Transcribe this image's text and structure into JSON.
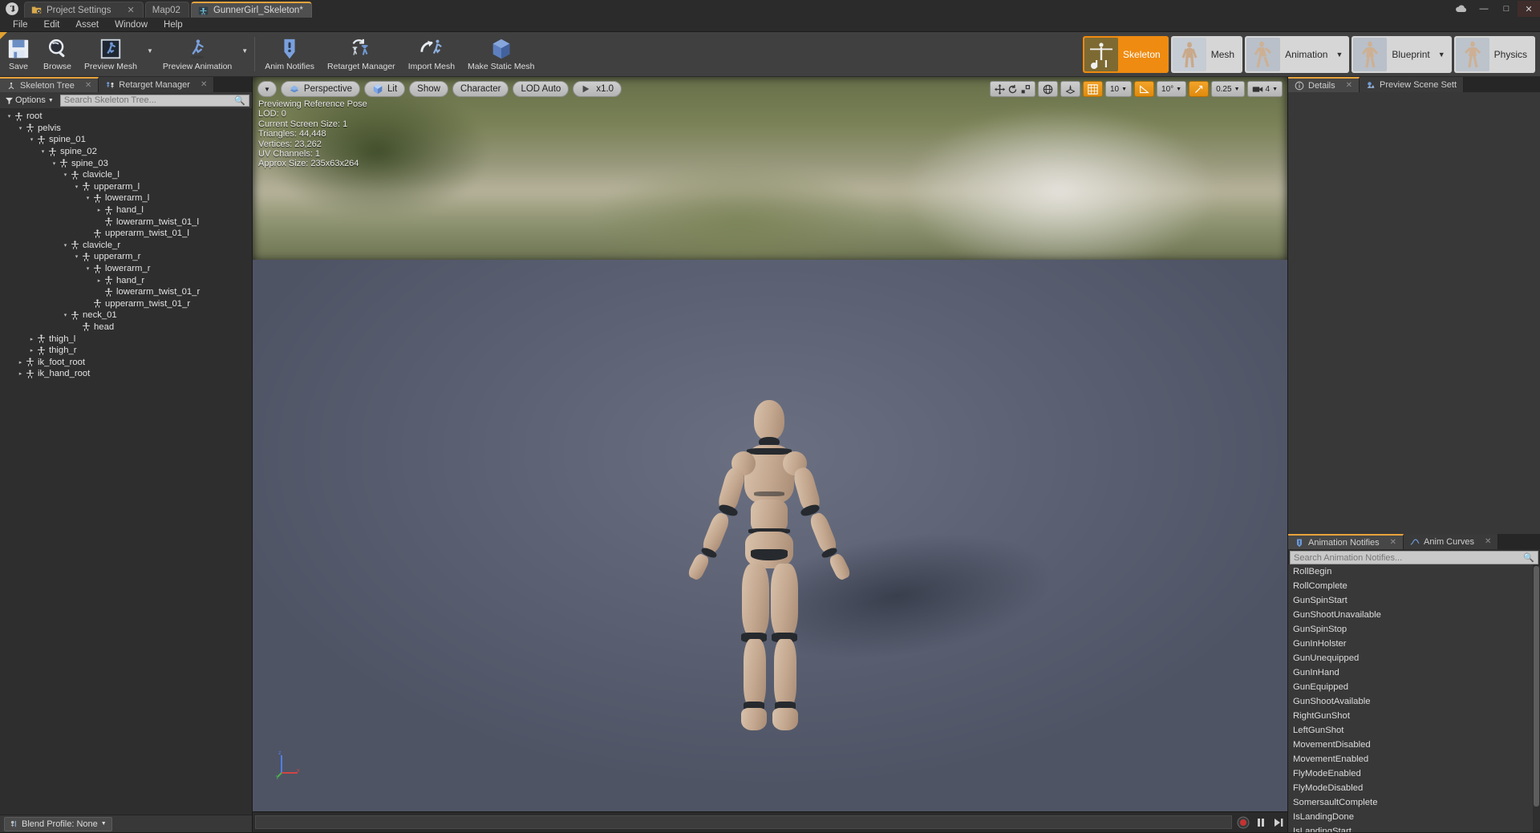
{
  "app": {
    "logo": "unreal-logo"
  },
  "titlebar": {
    "tabs": [
      {
        "label": "Project Settings",
        "icon": "settings-folder-icon",
        "closable": true,
        "state": "inactive"
      },
      {
        "label": "Map02",
        "icon": "",
        "closable": false,
        "state": "inactive"
      },
      {
        "label": "GunnerGirl_Skeleton*",
        "icon": "skeleton-icon",
        "closable": false,
        "state": "active"
      }
    ],
    "window_buttons": [
      "minimize",
      "maximize",
      "close"
    ],
    "extra_icon": "cloud-icon"
  },
  "menubar": {
    "items": [
      "File",
      "Edit",
      "Asset",
      "Window",
      "Help"
    ]
  },
  "toolbar": {
    "items": [
      {
        "label": "Save",
        "icon": "save-icon",
        "has_dropdown": false
      },
      {
        "label": "Browse",
        "icon": "browse-icon",
        "has_dropdown": false
      },
      {
        "label": "Preview Mesh",
        "icon": "preview-mesh-icon",
        "has_dropdown": true
      },
      {
        "label": "Preview Animation",
        "icon": "preview-animation-icon",
        "has_dropdown": true
      },
      {
        "label": "Anim Notifies",
        "icon": "anim-notifies-icon",
        "has_dropdown": false
      },
      {
        "label": "Retarget Manager",
        "icon": "retarget-manager-icon",
        "has_dropdown": false
      },
      {
        "label": "Import Mesh",
        "icon": "import-mesh-icon",
        "has_dropdown": false
      },
      {
        "label": "Make Static Mesh",
        "icon": "make-static-mesh-icon",
        "has_dropdown": false
      }
    ],
    "modes": [
      {
        "label": "Skeleton",
        "active": true,
        "has_dropdown": false
      },
      {
        "label": "Mesh",
        "active": false,
        "has_dropdown": false
      },
      {
        "label": "Animation",
        "active": false,
        "has_dropdown": true
      },
      {
        "label": "Blueprint",
        "active": false,
        "has_dropdown": true
      },
      {
        "label": "Physics",
        "active": false,
        "has_dropdown": false
      }
    ],
    "accent_color": "#ef8b10"
  },
  "left_panel": {
    "tabs": [
      {
        "label": "Skeleton Tree",
        "icon": "skeleton-tree-icon",
        "selected": true
      },
      {
        "label": "Retarget Manager",
        "icon": "retarget-manager-icon",
        "selected": false
      }
    ],
    "options_label": "Options",
    "search_placeholder": "Search Skeleton Tree...",
    "bones": [
      {
        "name": "root",
        "depth": 0,
        "arrow": "down"
      },
      {
        "name": "pelvis",
        "depth": 1,
        "arrow": "down"
      },
      {
        "name": "spine_01",
        "depth": 2,
        "arrow": "down"
      },
      {
        "name": "spine_02",
        "depth": 3,
        "arrow": "down"
      },
      {
        "name": "spine_03",
        "depth": 4,
        "arrow": "down"
      },
      {
        "name": "clavicle_l",
        "depth": 5,
        "arrow": "down"
      },
      {
        "name": "upperarm_l",
        "depth": 6,
        "arrow": "down"
      },
      {
        "name": "lowerarm_l",
        "depth": 7,
        "arrow": "down"
      },
      {
        "name": "hand_l",
        "depth": 8,
        "arrow": "right"
      },
      {
        "name": "lowerarm_twist_01_l",
        "depth": 8,
        "arrow": "none"
      },
      {
        "name": "upperarm_twist_01_l",
        "depth": 7,
        "arrow": "none"
      },
      {
        "name": "clavicle_r",
        "depth": 5,
        "arrow": "down"
      },
      {
        "name": "upperarm_r",
        "depth": 6,
        "arrow": "down"
      },
      {
        "name": "lowerarm_r",
        "depth": 7,
        "arrow": "down"
      },
      {
        "name": "hand_r",
        "depth": 8,
        "arrow": "right"
      },
      {
        "name": "lowerarm_twist_01_r",
        "depth": 8,
        "arrow": "none"
      },
      {
        "name": "upperarm_twist_01_r",
        "depth": 7,
        "arrow": "none"
      },
      {
        "name": "neck_01",
        "depth": 5,
        "arrow": "down"
      },
      {
        "name": "head",
        "depth": 6,
        "arrow": "none"
      },
      {
        "name": "thigh_l",
        "depth": 2,
        "arrow": "right"
      },
      {
        "name": "thigh_r",
        "depth": 2,
        "arrow": "right"
      },
      {
        "name": "ik_foot_root",
        "depth": 1,
        "arrow": "right"
      },
      {
        "name": "ik_hand_root",
        "depth": 1,
        "arrow": "right"
      }
    ],
    "blend_profile_label": "Blend Profile: None"
  },
  "viewport": {
    "toolbar": {
      "menu_caret": "chevron-down-icon",
      "view_mode": "Perspective",
      "lighting": "Lit",
      "show": "Show",
      "character": "Character",
      "lod": "LOD Auto",
      "playback_speed": "x1.0"
    },
    "toolbar_right": {
      "grid_snap_value": "10",
      "rotation_snap_value": "10°",
      "scale_snap_value": "0.25",
      "camera_speed_value": "4"
    },
    "stats": [
      "Previewing Reference Pose",
      "LOD: 0",
      "Current Screen Size: 1",
      "Triangles: 44,448",
      "Vertices: 23,262",
      "UV Channels: 1",
      "Approx Size: 235x63x264"
    ],
    "axis_labels": {
      "x": "x",
      "y": "y",
      "z": "z"
    }
  },
  "right_panel": {
    "top_tabs": [
      {
        "label": "Details",
        "icon": "details-icon",
        "selected": true,
        "closable": true
      },
      {
        "label": "Preview Scene Sett",
        "icon": "preview-scene-icon",
        "selected": false,
        "closable": false
      }
    ],
    "bottom_tabs": [
      {
        "label": "Animation Notifies",
        "icon": "notify-icon",
        "selected": true,
        "closable": true
      },
      {
        "label": "Anim Curves",
        "icon": "curves-icon",
        "selected": false,
        "closable": true
      }
    ],
    "notify_search_placeholder": "Search Animation Notifies...",
    "notifies": [
      "RollBegin",
      "RollComplete",
      "GunSpinStart",
      "GunShootUnavailable",
      "GunSpinStop",
      "GunInHolster",
      "GunUnequipped",
      "GunInHand",
      "GunEquipped",
      "GunShootAvailable",
      "RightGunShot",
      "LeftGunShot",
      "MovementDisabled",
      "MovementEnabled",
      "FlyModeEnabled",
      "FlyModeDisabled",
      "SomersaultComplete",
      "IsLandingDone",
      "IsLandingStart"
    ]
  },
  "timeline": {
    "record_label": "record",
    "pause_label": "pause",
    "step_label": "step-forward"
  }
}
